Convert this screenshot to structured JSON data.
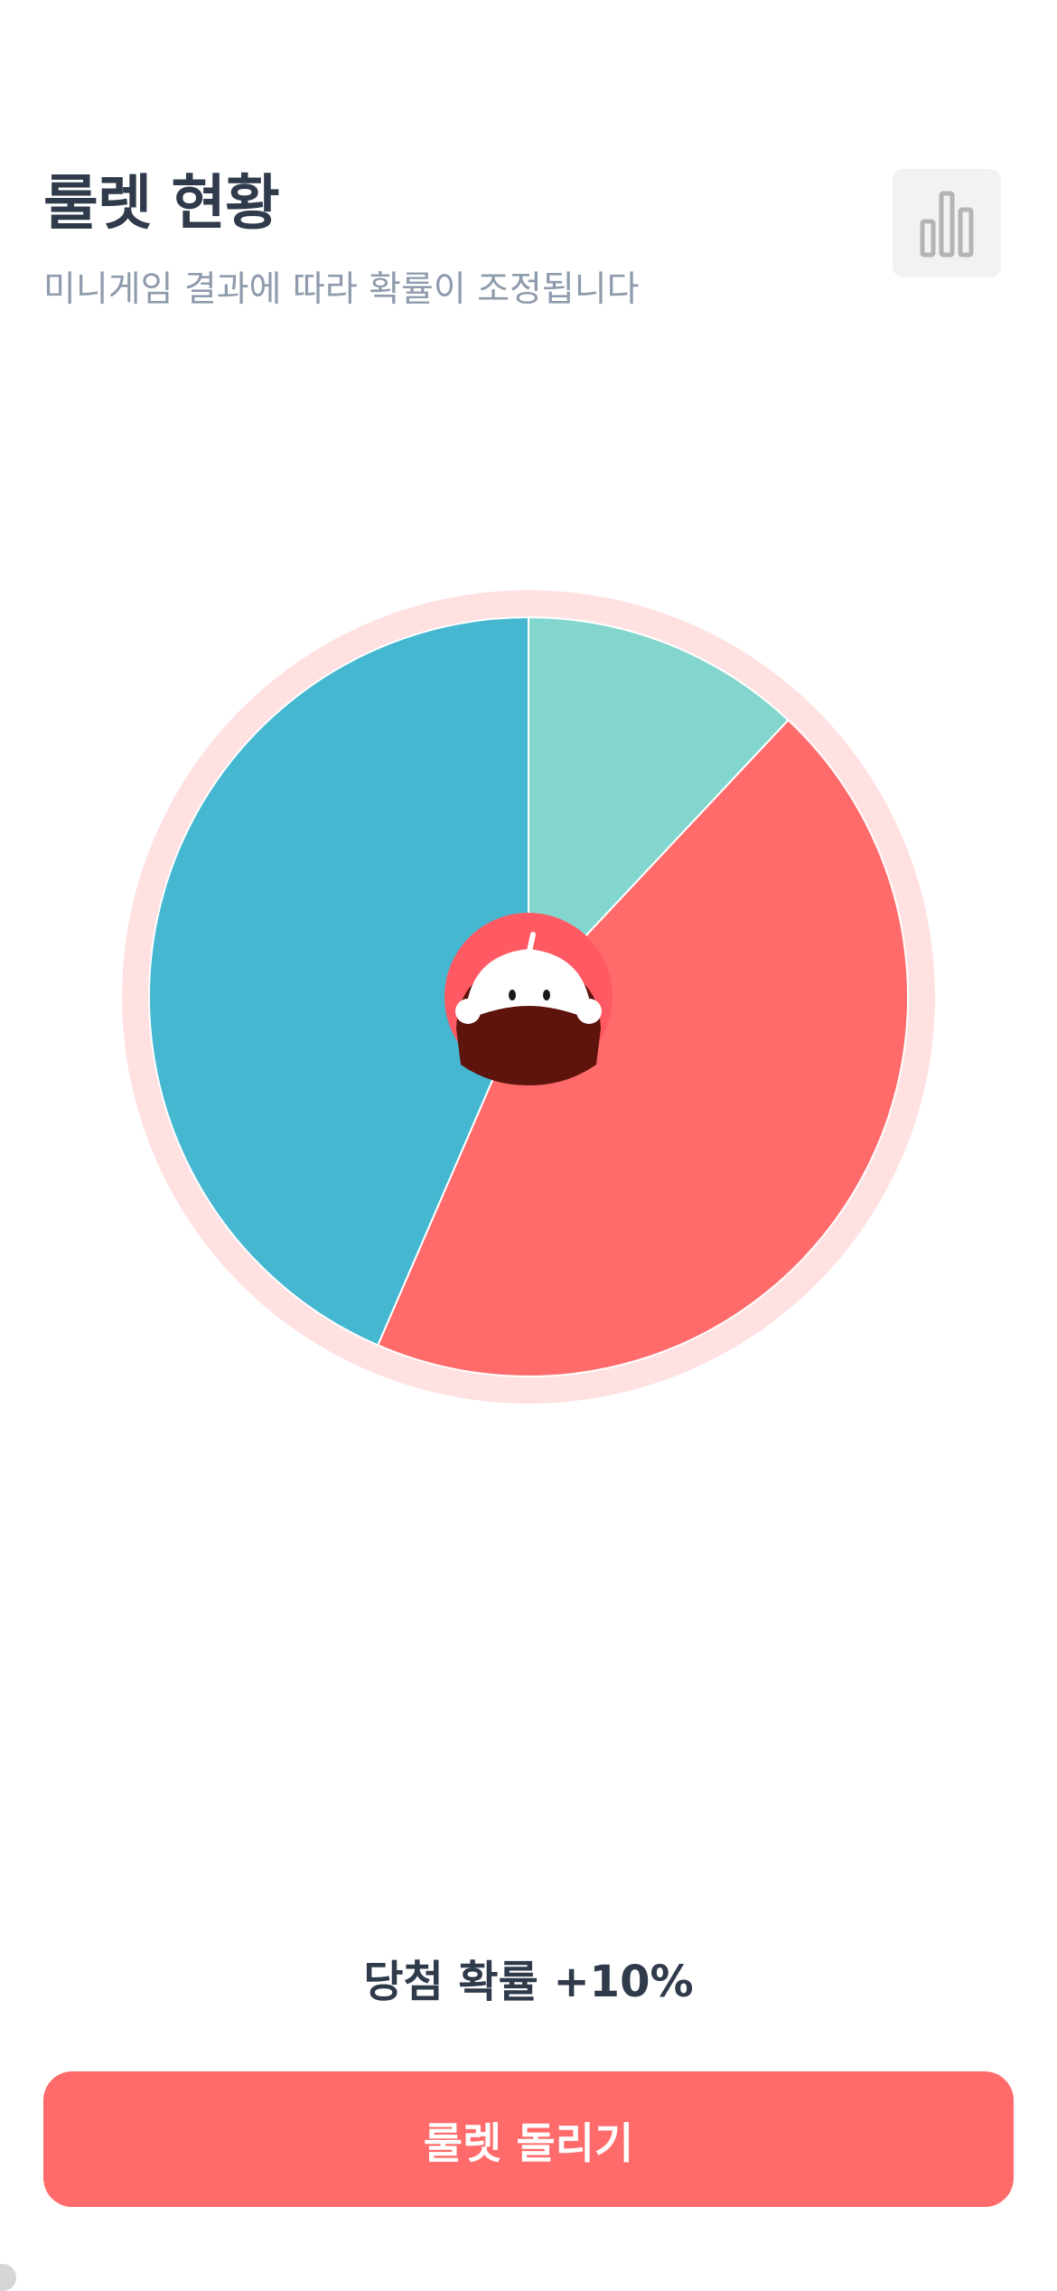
{
  "header": {
    "title": "룰렛 현황",
    "subtitle": "미니게임 결과에 따라 확률이 조정됩니다",
    "stats_icon": "bar-chart-icon"
  },
  "roulette": {
    "ring_color": "#ffe1e2",
    "center_icon": "mascot-icon",
    "center_color": "#ff5a63",
    "segments": [
      {
        "color": "#83d6ce",
        "share": 0.12
      },
      {
        "color": "#ff6b6b",
        "share": 0.445
      },
      {
        "color": "#45b7d1",
        "share": 0.435
      }
    ]
  },
  "probability": {
    "text": "당첨 확률 +10%"
  },
  "spin_button": {
    "label": "룰렛 돌리기",
    "color": "#ff6b6b"
  }
}
